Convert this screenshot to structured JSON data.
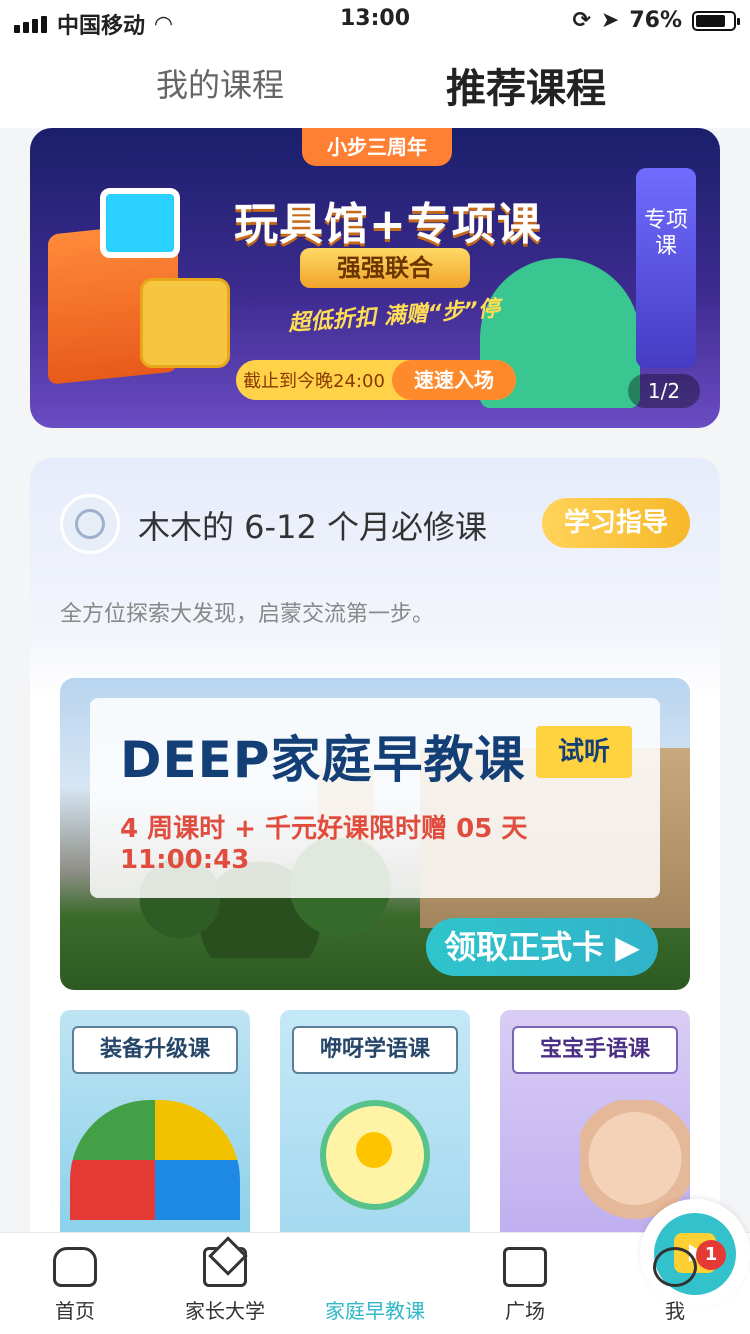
{
  "status_bar": {
    "carrier": "中国移动",
    "time": "13:00",
    "battery": "76%",
    "battery_level": 0.76,
    "icons": [
      "signal-icon",
      "wifi-icon",
      "screen-lock-icon",
      "location-arrow-icon",
      "battery-icon"
    ]
  },
  "header": {
    "tabs": [
      {
        "label": "我的课程",
        "active": false
      },
      {
        "label": "推荐课程",
        "active": true
      }
    ]
  },
  "banner": {
    "ribbon": "小步三周年",
    "title": "玩具馆+专项课",
    "subtitle": "强强联合",
    "tagline": "超低折扣 满赠“步”停",
    "deadline": "截止到今晚24:00",
    "cta": "速速入场",
    "book_label": "专项课",
    "counter": "1/2"
  },
  "course_card": {
    "title": "木木的 6-12 个月必修课",
    "guide_button": "学习指导",
    "description": "全方位探索大发现，启蒙交流第一步。",
    "featured": {
      "title": "DEEP家庭早教课",
      "trial_tag": "试听",
      "promo": "4 周课时 + 千元好课限时赠",
      "countdown": "05 天 11:00:43",
      "cta": "领取正式卡 ▶"
    },
    "mini_courses": [
      {
        "label": "装备升级课"
      },
      {
        "label": "咿呀学语课"
      },
      {
        "label": "宝宝手语课"
      }
    ]
  },
  "tab_bar": {
    "items": [
      {
        "label": "首页",
        "icon": "home-icon",
        "active": false
      },
      {
        "label": "家长大学",
        "icon": "graduation-cap-icon",
        "active": false
      },
      {
        "label": "家庭早教课",
        "icon": "tv-play-icon",
        "active": true
      },
      {
        "label": "广场",
        "icon": "book-open-icon",
        "active": false
      },
      {
        "label": "我",
        "icon": "profile-icon",
        "active": false
      }
    ],
    "badge": "1",
    "accent_color": "#2fb8c8"
  }
}
